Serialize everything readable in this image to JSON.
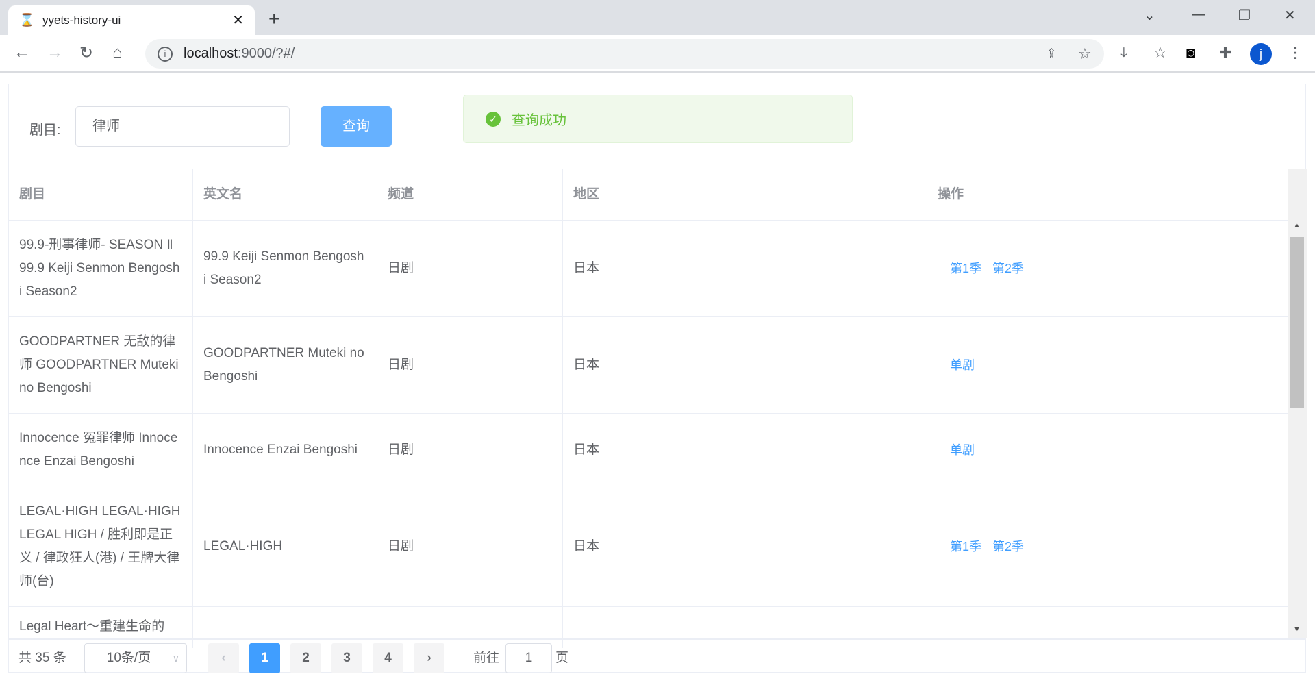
{
  "browser": {
    "tab_title": "yyets-history-ui",
    "url_host": "localhost",
    "url_rest": ":9000/?#/",
    "avatar_letter": "j"
  },
  "form": {
    "label": "剧目:",
    "input_value": "律师",
    "search_button": "查询"
  },
  "message": {
    "text": "查询成功"
  },
  "table": {
    "headers": [
      "剧目",
      "英文名",
      "频道",
      "地区",
      "操作"
    ],
    "rows": [
      {
        "title": "99.9-刑事律师- SEASON Ⅱ 99.9 Keiji Senmon Bengoshi Season2",
        "english": "99.9 Keiji Senmon Bengoshi Season2",
        "channel": "日剧",
        "area": "日本",
        "actions": [
          "第1季",
          "第2季"
        ]
      },
      {
        "title": "GOODPARTNER 无敌的律师 GOODPARTNER Muteki no Bengoshi",
        "english": "GOODPARTNER Muteki no Bengoshi",
        "channel": "日剧",
        "area": "日本",
        "actions": [
          "单剧"
        ]
      },
      {
        "title": "Innocence 冤罪律师 Innocence Enzai Bengoshi",
        "english": "Innocence Enzai Bengoshi",
        "channel": "日剧",
        "area": "日本",
        "actions": [
          "单剧"
        ]
      },
      {
        "title": "LEGAL·HIGH LEGAL·HIGH LEGAL HIGH / 胜利即是正义 / 律政狂人(港) / 王牌大律师(台)",
        "english": "LEGAL·HIGH",
        "channel": "日剧",
        "area": "日本",
        "actions": [
          "第1季",
          "第2季"
        ]
      },
      {
        "title": "Legal Heart～重建生命的",
        "english": "",
        "channel": "",
        "area": "",
        "actions": []
      }
    ]
  },
  "pagination": {
    "total": "共 35 条",
    "page_size": "10条/页",
    "pages": [
      "1",
      "2",
      "3",
      "4"
    ],
    "prev": "‹",
    "next": "›",
    "goto_label": "前往",
    "goto_value": "1",
    "goto_suffix": "页"
  }
}
